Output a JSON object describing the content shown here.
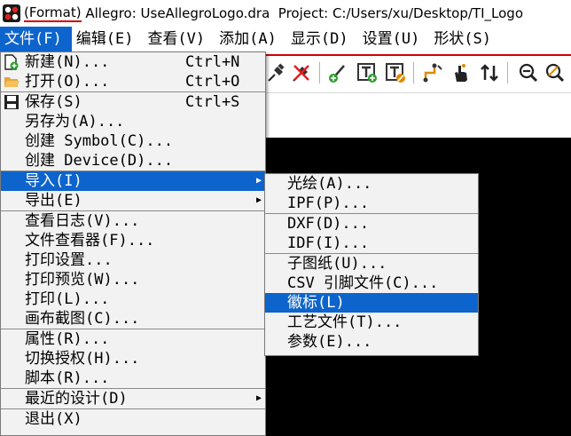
{
  "window": {
    "title_format": "(Format)",
    "title_rest": " Allegro: UseAllegroLogo.dra  Project: C:/Users/xu/Desktop/TI_Logo"
  },
  "menubar": [
    {
      "label": "文件(F)",
      "active": true
    },
    {
      "label": "编辑(E)"
    },
    {
      "label": "查看(V)"
    },
    {
      "label": "添加(A)"
    },
    {
      "label": "显示(D)"
    },
    {
      "label": "设置(U)"
    },
    {
      "label": "形状(S)"
    }
  ],
  "file_menu": {
    "items": [
      {
        "label": "新建(N)...",
        "shortcut": "Ctrl+N",
        "icon": "new-file-icon"
      },
      {
        "label": "打开(O)...",
        "shortcut": "Ctrl+O",
        "icon": "folder-open-icon"
      },
      {
        "label": "保存(S)",
        "shortcut": "Ctrl+S",
        "icon": "save-disk-icon"
      },
      {
        "label": "另存为(A)..."
      },
      {
        "label": "创建 Symbol(C)..."
      },
      {
        "label": "创建 Device(D)..."
      },
      {
        "label": "导入(I)",
        "submenu": true,
        "highlighted": true
      },
      {
        "label": "导出(E)",
        "submenu": true
      },
      {
        "label": "查看日志(V)..."
      },
      {
        "label": "文件查看器(F)..."
      },
      {
        "label": "打印设置..."
      },
      {
        "label": "打印预览(W)..."
      },
      {
        "label": "打印(L)..."
      },
      {
        "label": "画布截图(C)..."
      },
      {
        "label": "属性(R)..."
      },
      {
        "label": "切换授权(H)..."
      },
      {
        "label": "脚本(R)..."
      },
      {
        "label": "最近的设计(D)",
        "submenu": true
      },
      {
        "label": "退出(X)"
      }
    ]
  },
  "import_menu": {
    "items": [
      {
        "label": "光绘(A)..."
      },
      {
        "label": "IPF(P)..."
      },
      {
        "label": "DXF(D)..."
      },
      {
        "label": "IDF(I)..."
      },
      {
        "label": "子图纸(U)..."
      },
      {
        "label": "CSV 引脚文件(C)..."
      },
      {
        "label": "徽标(L)",
        "highlighted": true
      },
      {
        "label": "工艺文件(T)..."
      },
      {
        "label": "参数(E)..."
      }
    ]
  },
  "toolbar": {
    "icons": [
      "pin-icon",
      "unpin-icon",
      "add-line-icon",
      "add-text-icon",
      "edit-text-icon",
      "route-connect-icon",
      "hand-pointer-icon",
      "swap-arrows-icon",
      "zoom-out-icon",
      "zoom-search-icon"
    ]
  },
  "colors": {
    "menu_highlight": "#0d64cc",
    "menu_background": "#f2f2f2",
    "canvas_background": "#000000",
    "accent_red": "#d00000"
  }
}
